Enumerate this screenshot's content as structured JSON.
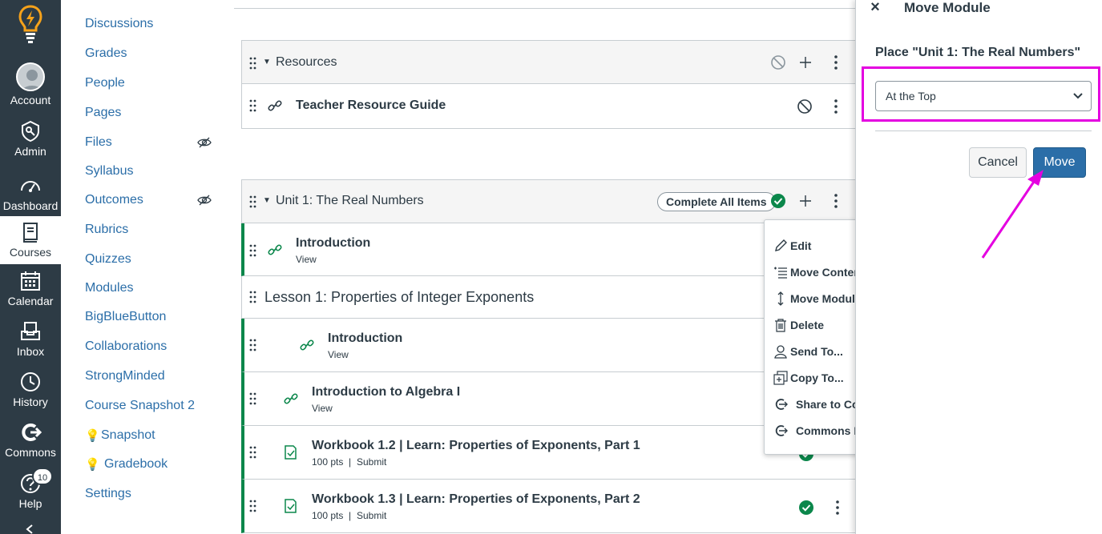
{
  "global_nav": {
    "items": [
      {
        "label": "Account",
        "icon": "account-avatar"
      },
      {
        "label": "Admin",
        "icon": "admin-shield-icon"
      },
      {
        "label": "Dashboard",
        "icon": "dashboard-gauge-icon"
      },
      {
        "label": "Courses",
        "icon": "courses-book-icon"
      },
      {
        "label": "Calendar",
        "icon": "calendar-icon"
      },
      {
        "label": "Inbox",
        "icon": "inbox-icon"
      },
      {
        "label": "History",
        "icon": "history-clock-icon"
      },
      {
        "label": "Commons",
        "icon": "commons-icon"
      },
      {
        "label": "Help",
        "icon": "help-icon",
        "badge": "10"
      }
    ]
  },
  "course_nav": {
    "items": [
      {
        "label": "Discussions"
      },
      {
        "label": "Grades"
      },
      {
        "label": "People"
      },
      {
        "label": "Pages"
      },
      {
        "label": "Files",
        "hidden": true
      },
      {
        "label": "Syllabus"
      },
      {
        "label": "Outcomes",
        "hidden": true
      },
      {
        "label": "Rubrics"
      },
      {
        "label": "Quizzes"
      },
      {
        "label": "Modules"
      },
      {
        "label": "BigBlueButton"
      },
      {
        "label": "Collaborations"
      },
      {
        "label": "StrongMinded"
      },
      {
        "label": "Course Snapshot 2"
      },
      {
        "label": "Snapshot",
        "prefix_icon": "lightbulb"
      },
      {
        "label": "Gradebook",
        "prefix_icon": "lightbulb"
      },
      {
        "label": "Settings"
      }
    ]
  },
  "modules": {
    "resources": {
      "title": "Resources",
      "items": [
        {
          "title": "Teacher Resource Guide",
          "icon": "link-icon"
        }
      ]
    },
    "unit1": {
      "title": "Unit 1: The Real Numbers",
      "complete_label": "Complete All Items",
      "items": [
        {
          "title": "Introduction",
          "sub": "View"
        },
        {
          "title": "Lesson 1: Properties of Integer Exponents",
          "type": "subheader"
        },
        {
          "title": "Introduction",
          "sub": "View"
        },
        {
          "title": "Introduction to Algebra I",
          "sub": "View"
        },
        {
          "title": "Workbook 1.2 | Learn: Properties of Exponents, Part 1",
          "sub_pts": "100 pts",
          "sub_sep": "|",
          "sub_action": "Submit"
        },
        {
          "title": "Workbook 1.3 | Learn: Properties of Exponents, Part 2",
          "sub_pts": "100 pts",
          "sub_sep": "|",
          "sub_action": "Submit"
        }
      ]
    }
  },
  "context_menu": {
    "items": [
      {
        "label": "Edit",
        "icon": "pencil-icon"
      },
      {
        "label": "Move Conter",
        "icon": "move-contents-icon"
      },
      {
        "label": "Move Module",
        "icon": "move-updown-icon"
      },
      {
        "label": "Delete",
        "icon": "trash-icon"
      },
      {
        "label": "Send To...",
        "icon": "user-icon"
      },
      {
        "label": "Copy To...",
        "icon": "copy-icon"
      },
      {
        "label": "Share to Co",
        "icon": "commons-share-icon"
      },
      {
        "label": "Commons Fa",
        "icon": "commons-favorites-icon"
      }
    ]
  },
  "tray": {
    "title": "Move Module",
    "place_label": "Place \"Unit 1: The Real Numbers\"",
    "select_value": "At the Top",
    "cancel_label": "Cancel",
    "move_label": "Move"
  },
  "colors": {
    "nav_bg": "#2d3b45",
    "link": "#2b6ea8",
    "success": "#0b874b",
    "highlight": "#e400e0",
    "primary_button": "#2b6ea8"
  }
}
